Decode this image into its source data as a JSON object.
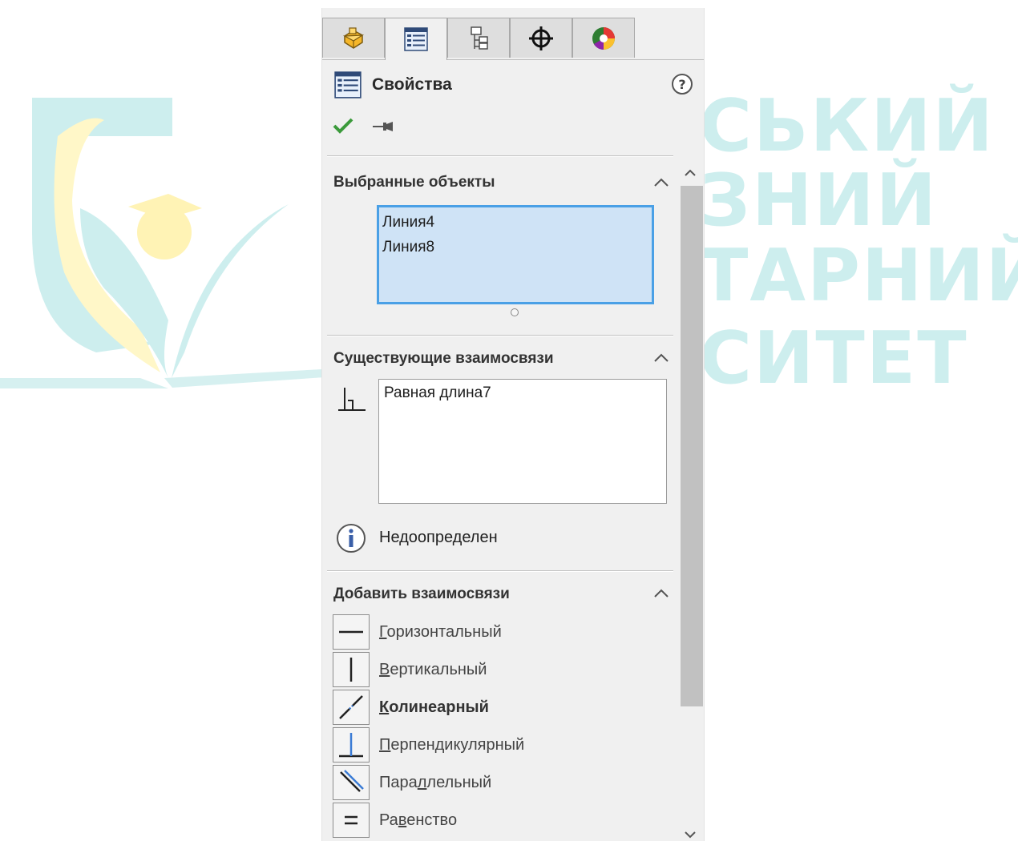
{
  "watermark": {
    "lines": [
      "СЬКИЙ",
      "ЗНИЙ",
      "ТАРНИЙ",
      "СИТЕТ"
    ],
    "color": "#cdeeee"
  },
  "tabs": [
    {
      "icon": "featuremanager-icon",
      "active": false
    },
    {
      "icon": "propertymanager-icon",
      "active": true
    },
    {
      "icon": "configurationmanager-icon",
      "active": false
    },
    {
      "icon": "dimxpertmanager-icon",
      "active": false
    },
    {
      "icon": "displaymanager-icon",
      "active": false
    }
  ],
  "header": {
    "title": "Свойства",
    "ok_icon": "checkmark-icon",
    "pin_icon": "pushpin-icon",
    "help_icon": "help-icon"
  },
  "selected_objects": {
    "heading": "Выбранные объекты",
    "items": [
      "Линия4",
      "Линия8"
    ]
  },
  "existing_relations": {
    "heading": "Существующие взаимосвязи",
    "items": [
      "Равная длина7"
    ],
    "status": "Недоопределен"
  },
  "add_relations": {
    "heading": "Добавить взаимосвязи",
    "items": [
      {
        "label": "Горизонтальный",
        "underline": "Г",
        "rest": "оризонтальный",
        "icon": "horizontal-relation-icon",
        "bold": false
      },
      {
        "label": "Вертикальный",
        "underline": "В",
        "rest": "ертикальный",
        "icon": "vertical-relation-icon",
        "bold": false
      },
      {
        "label": "Колинеарный",
        "underline": "К",
        "rest": "олинеарный",
        "icon": "collinear-relation-icon",
        "bold": true
      },
      {
        "label": "Перпендикулярный",
        "underline": "П",
        "rest": "ерпендикулярный",
        "icon": "perpendicular-relation-icon",
        "bold": false
      },
      {
        "label": "Параллельный",
        "pre": "Пара",
        "underline": "л",
        "rest": "лельный",
        "icon": "parallel-relation-icon",
        "bold": false
      },
      {
        "label": "Равенство",
        "pre": "Ра",
        "underline": "в",
        "rest": "енство",
        "icon": "equal-relation-icon",
        "bold": false
      }
    ]
  }
}
